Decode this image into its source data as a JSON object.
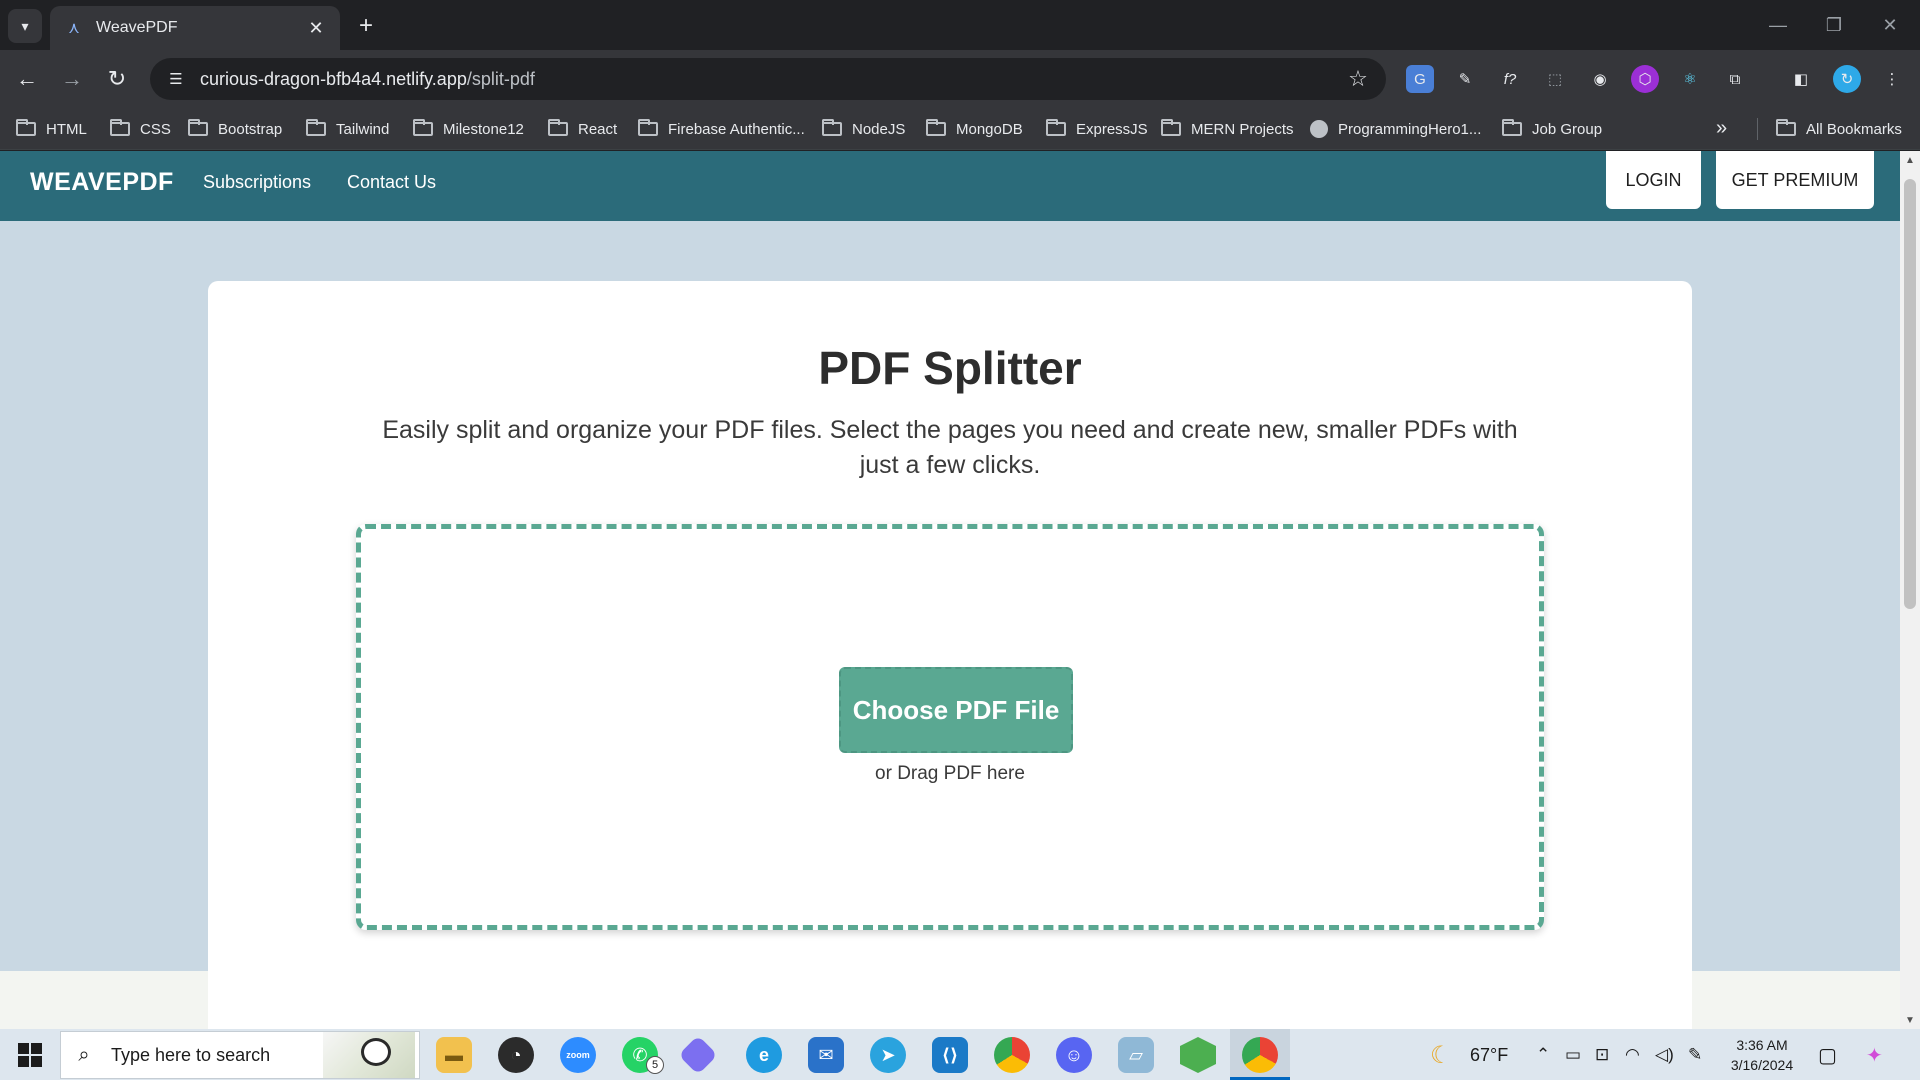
{
  "browser": {
    "tab_title": "WeavePDF",
    "url_domain": "curious-dragon-bfb4a4.netlify.app",
    "url_path": "/split-pdf",
    "bookmarks": [
      "HTML",
      "CSS",
      "Bootstrap",
      "Tailwind",
      "Milestone12",
      "React",
      "Firebase Authentic...",
      "NodeJS",
      "MongoDB",
      "ExpressJS",
      "MERN Projects",
      "ProgrammingHero1...",
      "Job Group"
    ],
    "all_bookmarks": "All Bookmarks"
  },
  "site": {
    "brand": "WEAVEPDF",
    "nav": [
      "Subscriptions",
      "Contact Us"
    ],
    "login": "LOGIN",
    "premium": "GET PREMIUM"
  },
  "main": {
    "title": "PDF Splitter",
    "description": "Easily split and organize your PDF files. Select the pages you need and create new, smaller PDFs with just a few clicks.",
    "choose_button": "Choose PDF File",
    "drag_text": "or Drag PDF here"
  },
  "taskbar": {
    "search_placeholder": "Type here to search",
    "whatsapp_badge": "5",
    "weather": "67°F",
    "time": "3:36 AM",
    "date": "3/16/2024"
  },
  "colors": {
    "nav_bg": "#2b6b7a",
    "accent": "#5aa892",
    "page_bg": "#c9d8e3"
  }
}
